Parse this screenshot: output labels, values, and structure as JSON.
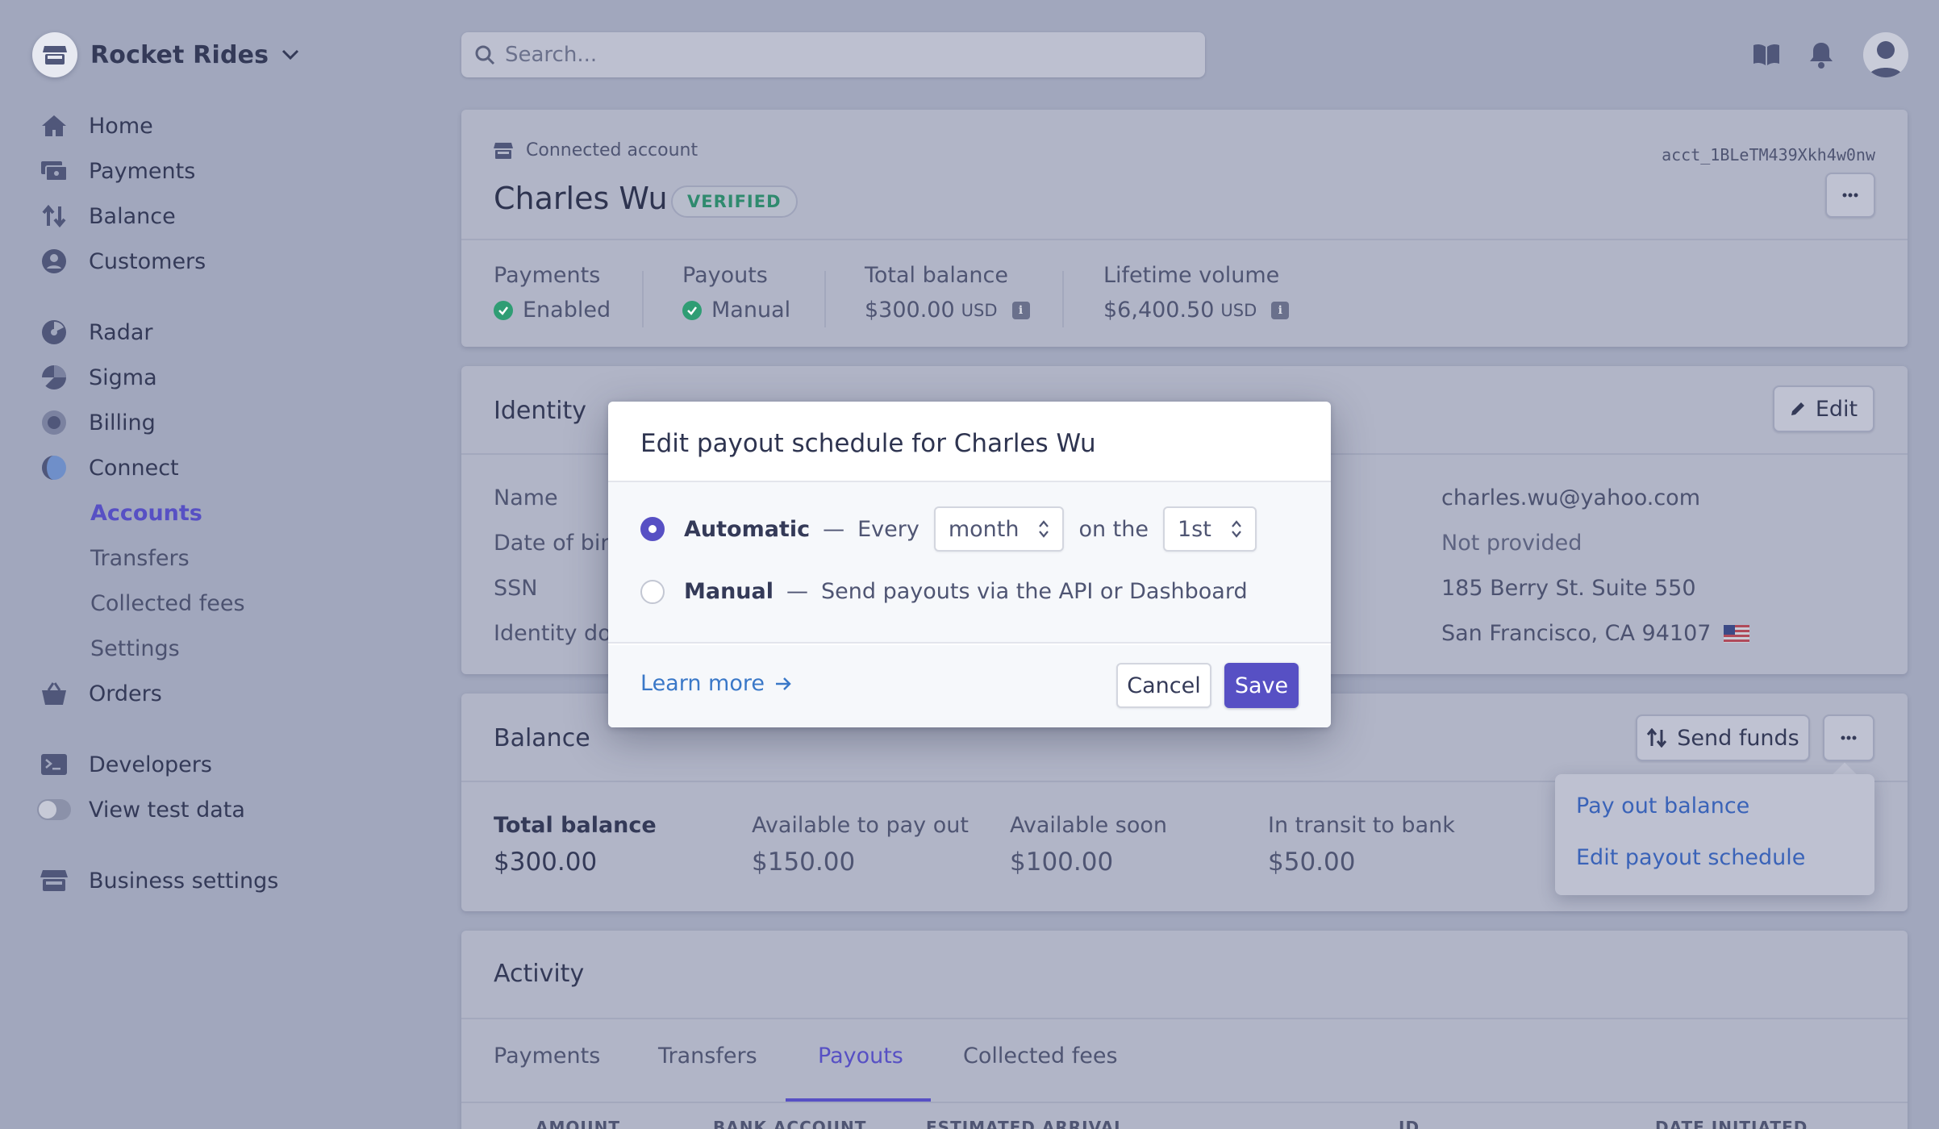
{
  "brand": {
    "name": "Rocket Rides"
  },
  "search": {
    "placeholder": "Search..."
  },
  "sidebar": {
    "items": [
      {
        "label": "Home",
        "icon": "home-icon"
      },
      {
        "label": "Payments",
        "icon": "payments-icon"
      },
      {
        "label": "Balance",
        "icon": "balance-icon"
      },
      {
        "label": "Customers",
        "icon": "customers-icon"
      },
      {
        "label": "Radar",
        "icon": "radar-icon"
      },
      {
        "label": "Sigma",
        "icon": "sigma-icon"
      },
      {
        "label": "Billing",
        "icon": "billing-icon"
      },
      {
        "label": "Connect",
        "icon": "connect-icon"
      },
      {
        "label": "Orders",
        "icon": "orders-icon"
      },
      {
        "label": "Developers",
        "icon": "terminal-icon"
      },
      {
        "label": "View test data",
        "icon": "toggle-switch"
      },
      {
        "label": "Business settings",
        "icon": "store-icon"
      }
    ],
    "connect_sub": [
      "Accounts",
      "Transfers",
      "Collected fees",
      "Settings"
    ],
    "active_sub": "Accounts"
  },
  "account": {
    "label": "Connected account",
    "id": "acct_1BLeTM439Xkh4w0nw",
    "name": "Charles Wu",
    "badge": "VERIFIED",
    "stats": [
      {
        "label": "Payments",
        "value": "Enabled"
      },
      {
        "label": "Payouts",
        "value": "Manual"
      },
      {
        "label": "Total balance",
        "value": "$300.00",
        "currency": "USD"
      },
      {
        "label": "Lifetime volume",
        "value": "$6,400.50",
        "currency": "USD"
      }
    ]
  },
  "identity": {
    "title": "Identity",
    "edit_label": "Edit",
    "labels": [
      "Name",
      "Date of birt",
      "SSN",
      "Identity doc"
    ],
    "values": [
      "charles.wu@yahoo.com",
      "Not provided",
      "185 Berry St. Suite 550",
      "San Francisco, CA 94107"
    ]
  },
  "balance": {
    "title": "Balance",
    "send_funds": "Send funds",
    "columns": [
      {
        "label": "Total balance",
        "value": "$300.00"
      },
      {
        "label": "Available to pay out",
        "value": "$150.00"
      },
      {
        "label": "Available soon",
        "value": "$100.00"
      },
      {
        "label": "In transit to bank",
        "value": "$50.00"
      }
    ]
  },
  "menu": {
    "items": [
      "Pay out balance",
      "Edit payout schedule"
    ]
  },
  "activity": {
    "title": "Activity",
    "tabs": [
      "Payments",
      "Transfers",
      "Payouts",
      "Collected fees"
    ],
    "active_tab": "Payouts",
    "columns": [
      "AMOUNT",
      "BANK ACCOUNT",
      "ESTIMATED ARRIVAL",
      "ID",
      "DATE INITIATED"
    ]
  },
  "modal": {
    "title": "Edit payout schedule for Charles Wu",
    "automatic_label": "Automatic",
    "dash": "—",
    "every": "Every",
    "interval": "month",
    "on_the": "on the",
    "day": "1st",
    "manual_label": "Manual",
    "manual_desc": "Send payouts via the API or Dashboard",
    "learn_more": "Learn more",
    "cancel": "Cancel",
    "save": "Save"
  },
  "colors": {
    "accent": "#5750c4",
    "link": "#3a78c8",
    "verified": "#2f8a6e",
    "overlay_bg": "#a1a7bd"
  }
}
